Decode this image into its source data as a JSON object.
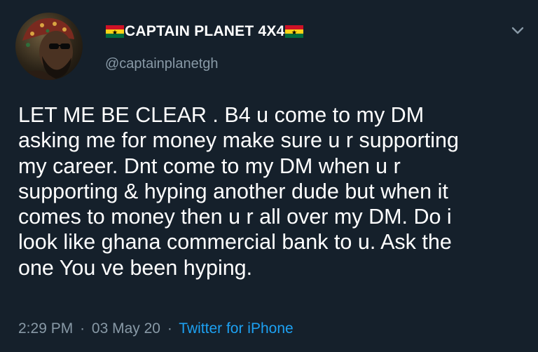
{
  "author": {
    "display_name": "CAPTAIN PLANET 4X4",
    "handle": "@captainplanetgh",
    "flag_left_icon": "ghana-flag-icon",
    "flag_right_icon": "ghana-flag-icon"
  },
  "tweet": {
    "lines": [
      "LET ME BE CLEAR . B4 u come to my DM",
      "asking me for money make sure u r supporting",
      "my career. Dnt come to my DM when u r",
      "supporting & hyping another dude but when it",
      "comes to money then u r all over my DM. Do i",
      "look like ghana commercial bank to u. Ask the",
      "one You ve been hyping."
    ]
  },
  "meta": {
    "time": "2:29 PM",
    "separator": "·",
    "date": "03 May 20",
    "source": "Twitter for iPhone"
  },
  "colors": {
    "background": "#15202b",
    "text": "#ffffff",
    "secondary": "#8899a6",
    "accent": "#1da1f2"
  }
}
